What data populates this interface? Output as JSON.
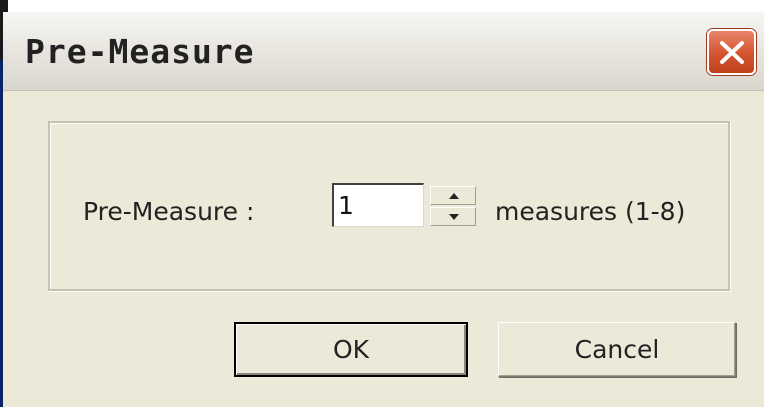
{
  "dialog": {
    "title": "Pre-Measure",
    "close_icon": "close-icon",
    "accent_color": "#d4552f"
  },
  "form": {
    "field_label": "Pre-Measure :",
    "value": "1",
    "units_label": "measures (1-8)",
    "spinner_up_icon": "arrow-up-icon",
    "spinner_down_icon": "arrow-down-icon"
  },
  "buttons": {
    "ok_label": "OK",
    "cancel_label": "Cancel"
  }
}
